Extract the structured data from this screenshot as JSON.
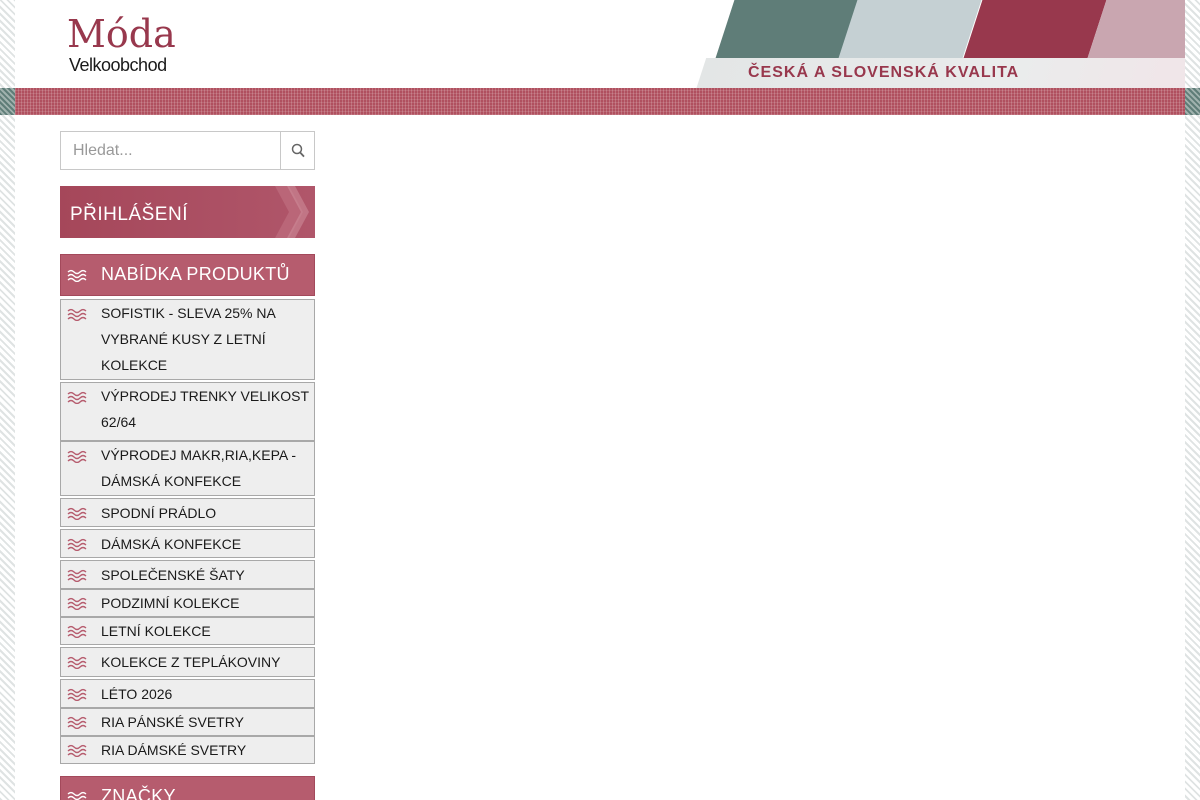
{
  "header": {
    "logo_main": "Móda",
    "logo_sub": "Velkoobchod",
    "tagline": "ČESKÁ A SLOVENSKÁ KVALITA",
    "colors": {
      "brand": "#98384d",
      "teal": "#5f7d78",
      "light": "#c5d0d3",
      "pink": "#c9a6b0"
    }
  },
  "search": {
    "placeholder": "Hledat...",
    "button_icon": "search-icon"
  },
  "login": {
    "label": "PŘIHLÁŠENÍ"
  },
  "products": {
    "header_label": "NABÍDKA PRODUKTŮ",
    "items": [
      {
        "label": "SOFISTIK - SLEVA 25% NA VYBRANÉ KUSY Z LETNÍ KOLEKCE"
      },
      {
        "label": "VÝPRODEJ TRENKY VELIKOST 62/64"
      },
      {
        "label": "VÝPRODEJ MAKR,RIA,KEPA - DÁMSKÁ KONFEKCE"
      },
      {
        "label": "SPODNÍ PRÁDLO"
      },
      {
        "label": "DÁMSKÁ KONFEKCE"
      },
      {
        "label": "SPOLEČENSKÉ ŠATY"
      },
      {
        "label": "PODZIMNÍ KOLEKCE"
      },
      {
        "label": "LETNÍ KOLEKCE"
      },
      {
        "label": "KOLEKCE Z TEPLÁKOVINY"
      },
      {
        "label": "LÉTO 2026"
      },
      {
        "label": "RIA PÁNSKÉ SVETRY"
      },
      {
        "label": "RIA DÁMSKÉ SVETRY"
      }
    ]
  },
  "brands": {
    "header_label": "ZNAČKY"
  }
}
